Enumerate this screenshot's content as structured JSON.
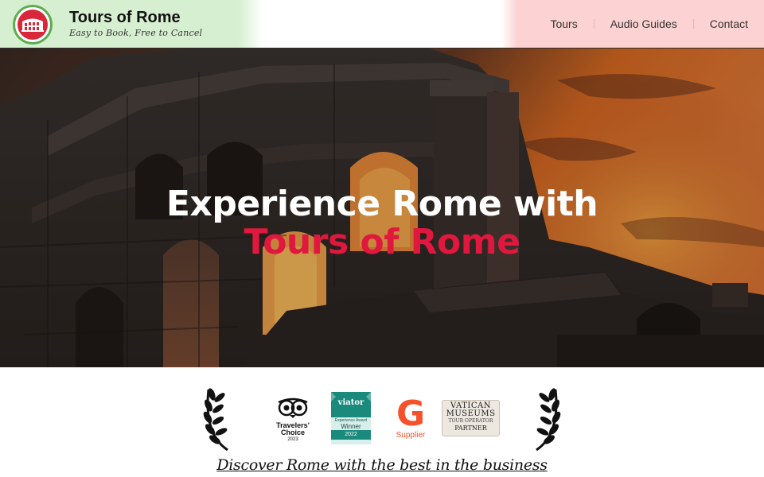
{
  "header": {
    "title": "Tours of Rome",
    "tagline": "Easy to Book, Free to Cancel",
    "nav": [
      {
        "label": "Tours"
      },
      {
        "label": "Audio Guides"
      },
      {
        "label": "Contact"
      }
    ]
  },
  "hero": {
    "line1": "Experience Rome with",
    "line2": "Tours of Rome"
  },
  "awards": {
    "tripadvisor": {
      "line1": "Travelers'",
      "line2": "Choice",
      "year": "2023"
    },
    "viator": {
      "brand": "viator",
      "award": "Experience Award",
      "title": "Winner",
      "year": "2022"
    },
    "getyourguide": {
      "letter": "G",
      "label": "Supplier"
    },
    "vatican": {
      "line1": "VATICAN",
      "line2": "MUSEUMS",
      "line3": "TOUR OPERATOR",
      "line4": "PARTNER"
    },
    "tagline": "Discover Rome with the best in the business"
  },
  "colors": {
    "accent_red": "#e0183d",
    "logo_green": "#5cad4e",
    "header_left": "#d7efd1",
    "header_right": "#fdd2d2",
    "gyg_orange": "#f5522b",
    "viator_teal": "#1a8a7c"
  }
}
